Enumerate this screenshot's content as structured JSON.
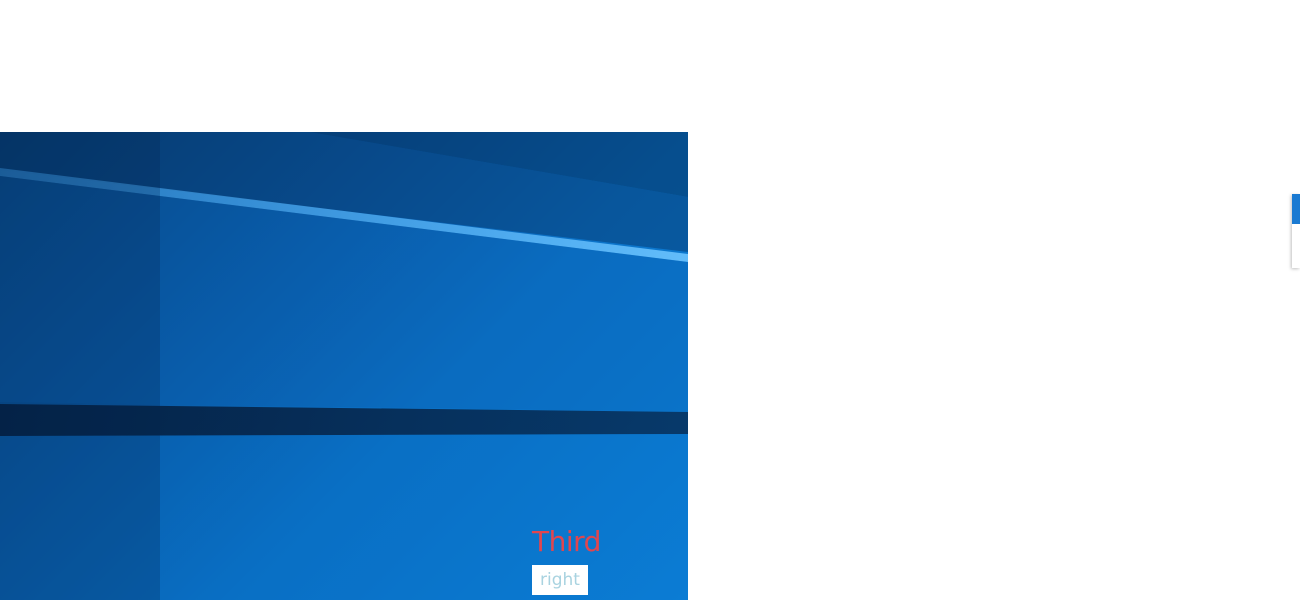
{
  "slide": {
    "image_description_icon": "windows-desktop-wallpaper-image",
    "caption_title": "Third",
    "caption_tag": "right",
    "caption_title_color": "#e0464f",
    "caption_tag_color": "#a9d3e0"
  },
  "edge_widget": {
    "accent_color": "#1a7ad2"
  }
}
